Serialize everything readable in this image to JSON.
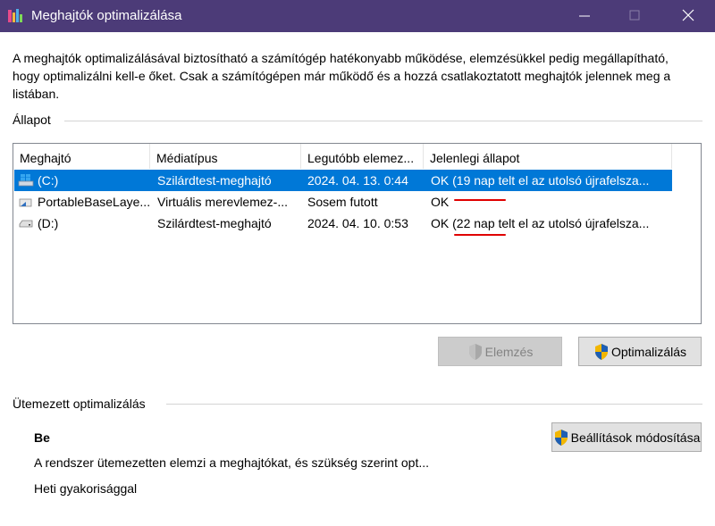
{
  "window": {
    "title": "Meghajtók optimalizálása",
    "title_bar_color": "#4c3b78"
  },
  "description": "A meghajtók optimalizálásával biztosítható a számítógép hatékonyabb működése, elemzésükkel pedig megállapítható, hogy optimalizálni kell-e őket. Csak a számítógépen már működő és a hozzá csatlakoztatott meghajtók jelennek meg a listában.",
  "status_section": {
    "label": "Állapot"
  },
  "drive_list": {
    "headers": [
      "Meghajtó",
      "Médiatípus",
      "Legutóbb elemez...",
      "Jelenlegi állapot"
    ],
    "rows": [
      {
        "icon": "windows-drive-icon",
        "drive": "(C:)",
        "media": "Szilárdtest-meghajtó",
        "last": "2024. 04. 13. 0:44",
        "status": "OK (19 nap telt el az utolsó újrafelsza...",
        "selected": true
      },
      {
        "icon": "virtual-disk-icon",
        "drive": "PortableBaseLaye...",
        "media": "Virtuális merevlemez-...",
        "last": "Sosem futott",
        "status": "OK",
        "selected": false
      },
      {
        "icon": "drive-icon",
        "drive": "(D:)",
        "media": "Szilárdtest-meghajtó",
        "last": "2024. 04. 10. 0:53",
        "status": "OK (22 nap telt el az utolsó újrafelsza...",
        "selected": false
      }
    ],
    "selection_color": "#0078d7"
  },
  "buttons": {
    "analyze": "Elemzés",
    "optimize": "Optimalizálás",
    "change_settings": "Beállítások módosítása"
  },
  "schedule_section": {
    "label": "Ütemezett optimalizálás",
    "state": "Be",
    "description": "A rendszer ütemezetten elemzi a meghajtókat, és szükség szerint opt...",
    "frequency": "Heti gyakorisággal"
  },
  "annotation_color": "#e00000"
}
